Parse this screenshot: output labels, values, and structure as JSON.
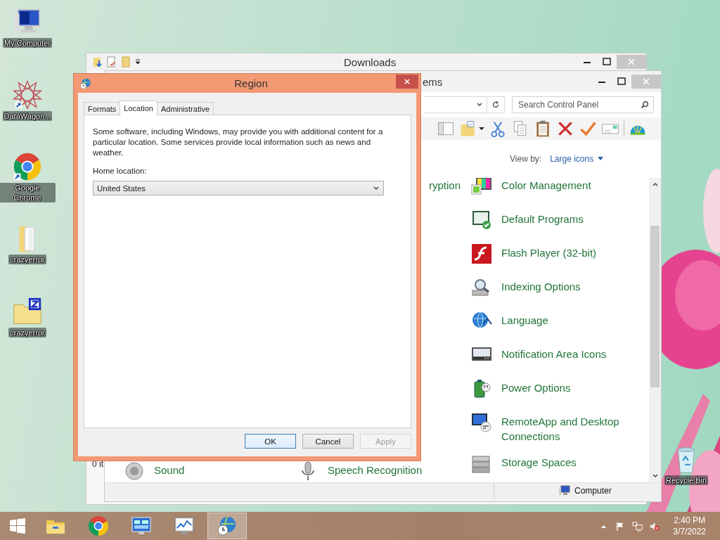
{
  "desktop_icons": [
    {
      "label": "My Computer",
      "kind": "computer"
    },
    {
      "label": "DataWagon...",
      "kind": "star"
    },
    {
      "label": "Google Chrome",
      "kind": "chrome"
    },
    {
      "label": "crazyerror",
      "kind": "folder"
    },
    {
      "label": "crazyerror",
      "kind": "zip"
    },
    {
      "label": "Recycle Bin",
      "kind": "recycle"
    }
  ],
  "downloads_window": {
    "title": "Downloads",
    "status_text": "0 it"
  },
  "control_panel": {
    "title": "ems",
    "search": {
      "placeholder": "Search Control Panel"
    },
    "view_by_label": "View by:",
    "view_by_value": "Large icons",
    "top_left_item": {
      "label": "ryption"
    },
    "items": [
      {
        "label": "Color Management",
        "kind": "color"
      },
      {
        "label": "Default Programs",
        "kind": "programs"
      },
      {
        "label": "Flash Player (32-bit)",
        "kind": "flash"
      },
      {
        "label": "Indexing Options",
        "kind": "indexing"
      },
      {
        "label": "Language",
        "kind": "language"
      },
      {
        "label": "Notification Area Icons",
        "kind": "notification"
      },
      {
        "label": "Power Options",
        "kind": "power"
      },
      {
        "label": "RemoteApp and Desktop Connections",
        "kind": "remote"
      },
      {
        "label": "Storage Spaces",
        "kind": "storage"
      }
    ],
    "bottom_items": [
      {
        "label": "Sound",
        "kind": "sound"
      },
      {
        "label": "Speech Recognition",
        "kind": "microphone"
      }
    ],
    "status_bar": {
      "location": "Computer"
    }
  },
  "region_dialog": {
    "title": "Region",
    "tabs": [
      {
        "label": "Formats",
        "selected": false
      },
      {
        "label": "Location",
        "selected": true
      },
      {
        "label": "Administrative",
        "selected": false
      }
    ],
    "description": "Some software, including Windows, may provide you with additional content for a particular location. Some services provide local information such as news and weather.",
    "home_location_label": "Home location:",
    "home_location": "United States",
    "buttons": [
      {
        "label": "OK",
        "disabled": false,
        "default": true
      },
      {
        "label": "Cancel",
        "disabled": false,
        "default": false
      },
      {
        "label": "Apply",
        "disabled": true,
        "default": false
      }
    ]
  },
  "taskbar": {
    "apps": [
      {
        "kind": "explorer",
        "selected": false
      },
      {
        "kind": "chrome",
        "selected": false
      },
      {
        "kind": "control",
        "selected": false
      },
      {
        "kind": "monitor",
        "selected": false
      },
      {
        "kind": "region",
        "selected": true
      }
    ],
    "time": "2:40 PM",
    "date": "3/7/2022"
  }
}
